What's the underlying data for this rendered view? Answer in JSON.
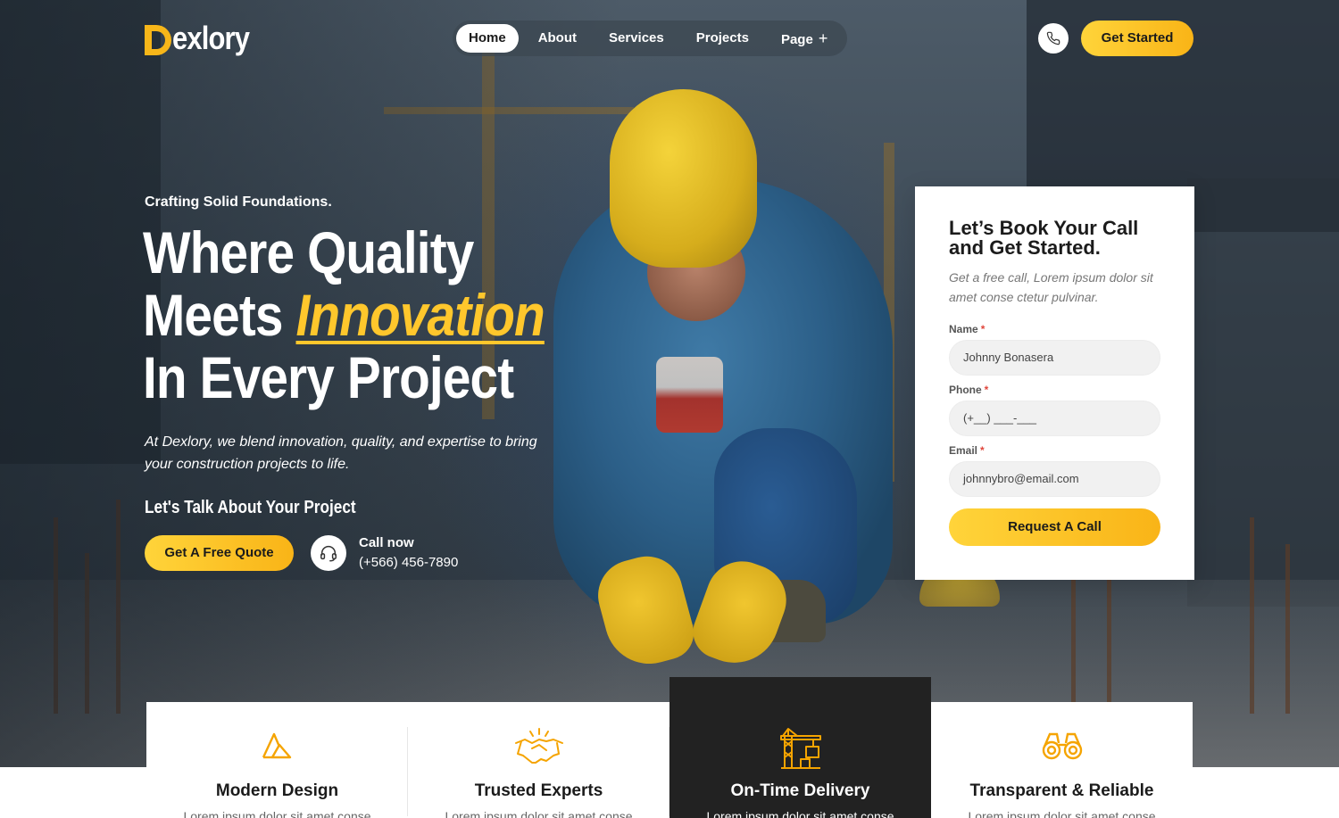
{
  "brand": {
    "name": "exlory",
    "accent": "#f9b417"
  },
  "nav": {
    "items": [
      {
        "label": "Home",
        "active": true
      },
      {
        "label": "About"
      },
      {
        "label": "Services"
      },
      {
        "label": "Projects"
      },
      {
        "label": "Page",
        "expand": "+"
      }
    ]
  },
  "header": {
    "phone_icon": "phone-icon",
    "cta_label": "Get Started"
  },
  "hero": {
    "tagline": "Crafting Solid Foundations.",
    "headline": {
      "line1": "Where Quality",
      "line2_prefix": "Meets ",
      "highlight": "Innovation",
      "line3": "In Every Project"
    },
    "description": "At Dexlory, we blend innovation, quality, and expertise to bring your construction projects to life.",
    "talk_label": "Let's Talk About Your Project",
    "quote_button": "Get A Free Quote",
    "call": {
      "label": "Call now",
      "number": "(+566) 456-7890",
      "icon": "headset-icon"
    }
  },
  "form": {
    "title": "Let’s Book Your Call and Get Started.",
    "subtitle": "Get a free call, Lorem ipsum dolor sit amet conse ctetur pulvinar.",
    "fields": [
      {
        "label": "Name",
        "required": "*",
        "value": "Johnny Bonasera"
      },
      {
        "label": "Phone",
        "required": "*",
        "value": "(+__) ___-___"
      },
      {
        "label": "Email",
        "required": "*",
        "value": "johnnybro@email.com"
      }
    ],
    "submit": "Request A Call"
  },
  "features": [
    {
      "title": "Modern Design",
      "text": "Lorem ipsum dolor sit amet conse",
      "icon": "modern-design-icon"
    },
    {
      "title": "Trusted Experts",
      "text": "Lorem ipsum dolor sit amet conse",
      "icon": "handshake-icon"
    },
    {
      "title": "On-Time Delivery",
      "text": "Lorem ipsum dolor sit amet conse",
      "icon": "crane-icon",
      "highlighted": true
    },
    {
      "title": "Transparent & Reliable",
      "text": "Lorem ipsum dolor sit amet conse",
      "icon": "binoculars-icon"
    }
  ]
}
